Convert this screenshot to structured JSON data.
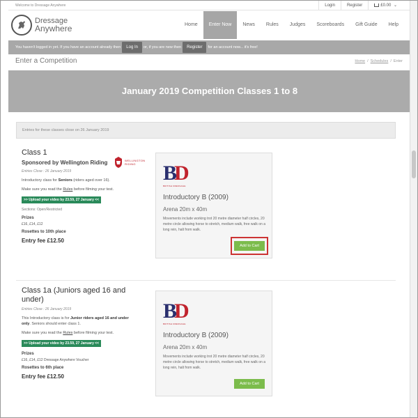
{
  "topbar": {
    "welcome": "Welcome to Dressage Anywhere",
    "login": "Login",
    "register": "Register",
    "cart_total": "£0.00"
  },
  "logo": {
    "line1": "Dressage",
    "line2": "Anywhere"
  },
  "nav": {
    "items": [
      {
        "label": "Home",
        "active": false
      },
      {
        "label": "Enter Now",
        "active": true
      },
      {
        "label": "News",
        "active": false
      },
      {
        "label": "Rules",
        "active": false
      },
      {
        "label": "Judges",
        "active": false
      },
      {
        "label": "Scoreboards",
        "active": false
      },
      {
        "label": "Gift Guide",
        "active": false
      },
      {
        "label": "Help",
        "active": false
      }
    ]
  },
  "login_bar": {
    "text_before": "You haven't logged in yet. If you have an account already then",
    "login_button": "Log In",
    "text_middle": "or, if you are new then",
    "register_button": "Register",
    "text_after": "for an account now... it's free!"
  },
  "page": {
    "title": "Enter a Competition",
    "breadcrumb": [
      "Home",
      "Schedules",
      "Enter"
    ]
  },
  "banner": {
    "title": "January 2019 Competition Classes 1 to 8"
  },
  "notice": {
    "text": "Entries for these classes close on 26 January 2019"
  },
  "classes": [
    {
      "title": "Class 1",
      "subtitle": "Sponsored by Wellington Riding",
      "entries_close": "Entries Close : 26 January 2019",
      "desc_prefix": "Introductory class for ",
      "desc_bold": "Seniors",
      "desc_suffix": " (riders aged over 16).",
      "rules_prefix": "Make sure you read the ",
      "rules_link": "Rules",
      "rules_suffix": " before filming your test.",
      "upload": ">> Upload your video by 23.59, 27 January <<",
      "sections": "Sections: Open/Restricted",
      "prizes_label": "Prizes",
      "prizes": "£16, £14, £12",
      "rosettes": "Rosettes to 10th place",
      "fee": "Entry fee £12.50",
      "sponsor_text_1": "WELLINGTON",
      "sponsor_text_2": "RIDING",
      "test": {
        "logo_caption": "BRITISH DRESSAGE",
        "name": "Introductory B (2009)",
        "arena": "Arena 20m x 40m",
        "description": "Movements include working trot 20 metre diameter half circles, 20 metre circle allowing horse to stretch, medium walk, free walk on a long rein, halt from walk.",
        "cart_label": "Add to Cart"
      }
    },
    {
      "title": "Class 1a (Juniors aged 16 and under)",
      "entries_close": "Entries Close : 26 January 2019",
      "desc_prefix": "This Introductory class is for ",
      "desc_bold": "Junior riders aged 16 and under only",
      "desc_suffix": ". Seniors should enter class 1.",
      "rules_prefix": "Make sure you read the ",
      "rules_link": "Rules",
      "rules_suffix": " before filming your test.",
      "upload": ">> Upload your video by 23.59, 27 January <<",
      "prizes_label": "Prizes",
      "prizes": "£16, £14, £12 Dressage Anywhere Voucher",
      "rosettes": "Rosettes to 6th place",
      "fee": "Entry fee £12.50",
      "test": {
        "logo_caption": "BRITISH DRESSAGE",
        "name": "Introductory B (2009)",
        "arena": "Arena 20m x 40m",
        "description": "Movements include working trot 20 metre diameter half circles, 20 metre circle allowing horse to stretch, medium walk, free walk on a long rein, halt from walk.",
        "cart_label": "Add to Cart"
      }
    }
  ],
  "colors": {
    "banner": "#ababab",
    "login_bar": "#a8a8a8",
    "cart_button": "#7cbc4c",
    "upload_badge": "#2a8a5a",
    "highlight": "#cc3333"
  }
}
